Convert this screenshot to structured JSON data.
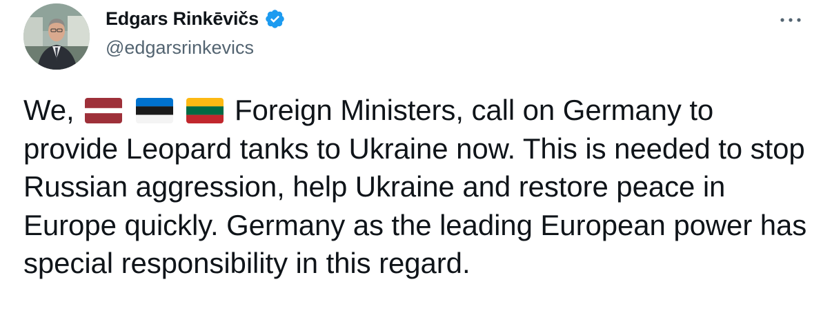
{
  "author": {
    "display_name": "Edgars Rinkēvičs",
    "handle": "@edgarsrinkevics",
    "verified": true
  },
  "tweet": {
    "text_before_flags": "We,",
    "flags": [
      "latvia-flag",
      "estonia-flag",
      "lithuania-flag"
    ],
    "text_after_flags": "Foreign Ministers, call on Germany to provide Leopard tanks to Ukraine now. This is needed to stop Russian aggression, help Ukraine and restore peace in Europe quickly. Germany as the leading European power has special responsibility in this regard."
  },
  "icons": {
    "verified": "verified-badge-icon",
    "more": "more-options-icon"
  },
  "colors": {
    "text": "#0f1419",
    "secondary_text": "#536471",
    "verified_blue": "#1d9bf0",
    "latvia_red": "#9e3039",
    "estonia_blue": "#0072ce",
    "lithuania_yellow": "#fdb913",
    "lithuania_green": "#006a44",
    "lithuania_red": "#c1272d"
  }
}
